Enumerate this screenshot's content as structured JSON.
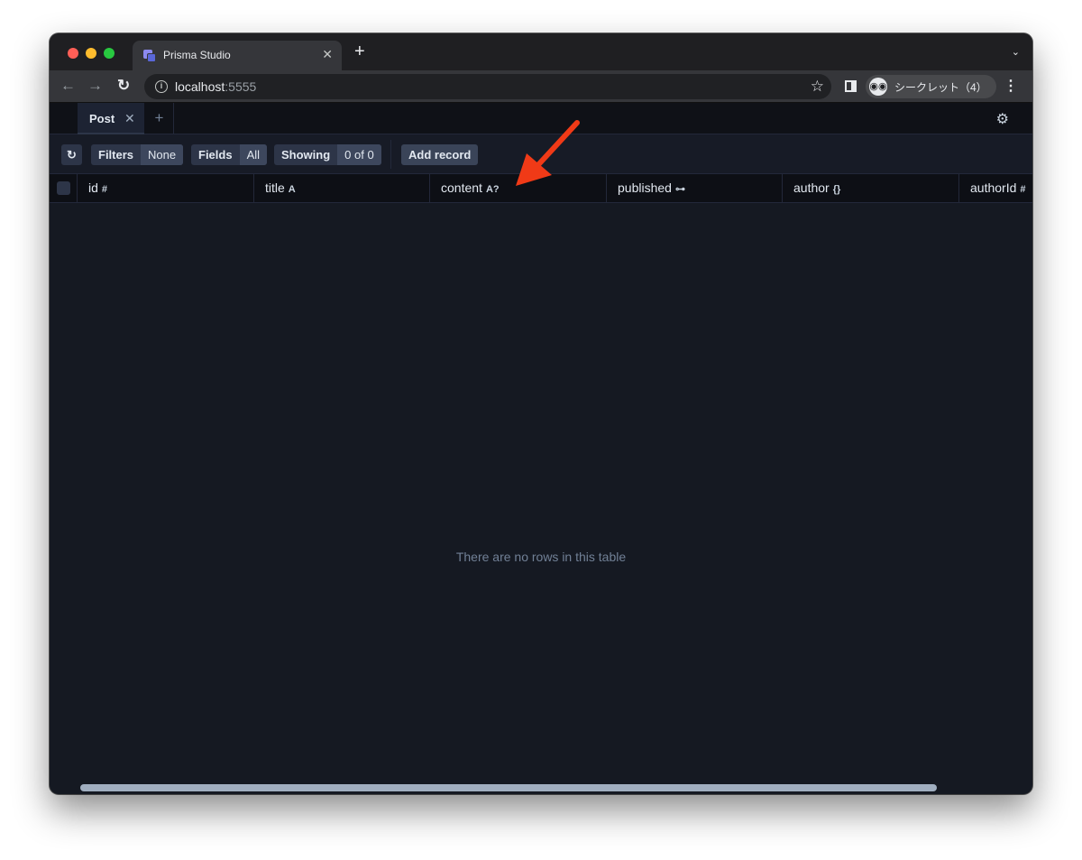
{
  "browser": {
    "tab_title": "Prisma Studio",
    "tab_close": "✕",
    "new_tab": "+",
    "tab_search": "⌄",
    "url_host": "localhost",
    "url_port": ":5555",
    "incognito_label": "シークレット（4）",
    "incognito_icon": "incognito-icon"
  },
  "studio": {
    "tabs": [
      {
        "label": "Post",
        "close": "✕"
      }
    ],
    "add_tab": "+",
    "actions": {
      "refresh_icon": "↻",
      "filters_label": "Filters",
      "filters_value": "None",
      "fields_label": "Fields",
      "fields_value": "All",
      "showing_label": "Showing",
      "showing_value": "0 of 0",
      "add_record_label": "Add record"
    },
    "columns": [
      {
        "name": "id",
        "type": "#"
      },
      {
        "name": "title",
        "type": "A"
      },
      {
        "name": "content",
        "type": "A?"
      },
      {
        "name": "published",
        "type": "⊶"
      },
      {
        "name": "author",
        "type": "{}"
      },
      {
        "name": "authorId",
        "type": "#"
      }
    ],
    "empty_message": "There are no rows in this table"
  },
  "colors": {
    "background": "#151922",
    "annotation_arrow": "#f03a17"
  }
}
